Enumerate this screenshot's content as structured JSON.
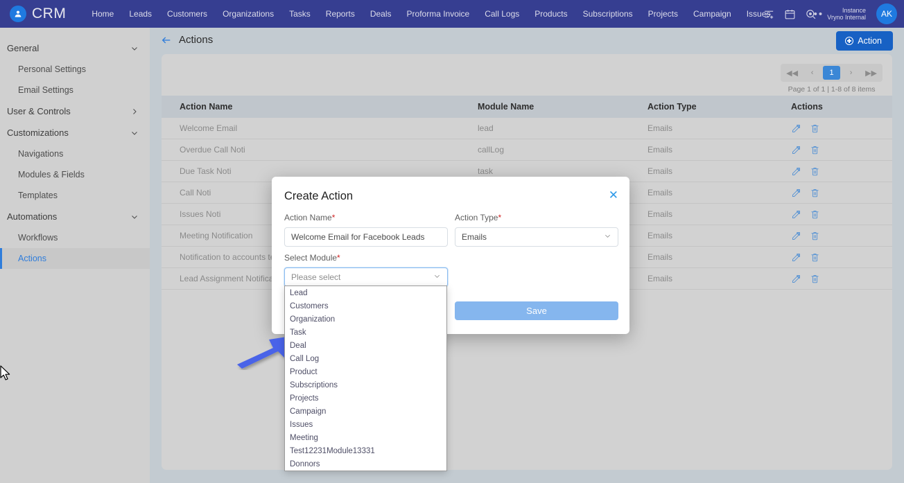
{
  "topnav": {
    "brand": "CRM",
    "links": [
      "Home",
      "Leads",
      "Customers",
      "Organizations",
      "Tasks",
      "Reports",
      "Deals",
      "Proforma Invoice",
      "Call Logs",
      "Products",
      "Subscriptions",
      "Projects",
      "Campaign",
      "Issues"
    ],
    "more": "•••",
    "instance_label": "Instance",
    "instance_name": "Vryno Internal",
    "avatar_initials": "AK",
    "bg_color": "#363e91"
  },
  "sidebar": {
    "groups": [
      {
        "label": "General",
        "expanded": true,
        "items": [
          "Personal Settings",
          "Email Settings"
        ]
      },
      {
        "label": "User & Controls",
        "expanded": false,
        "items": []
      },
      {
        "label": "Customizations",
        "expanded": true,
        "items": [
          "Navigations",
          "Modules & Fields",
          "Templates"
        ]
      },
      {
        "label": "Automations",
        "expanded": true,
        "items": [
          "Workflows",
          "Actions"
        ]
      }
    ],
    "active_item": "Actions"
  },
  "page": {
    "title": "Actions",
    "create_button": "Action"
  },
  "pagination": {
    "first": "◀◀",
    "prev": "‹",
    "current": "1",
    "next": "›",
    "last": "▶▶",
    "info": "Page 1 of 1   |   1-8 of 8 items"
  },
  "table": {
    "columns": [
      "Action Name",
      "Module Name",
      "Action Type",
      "Actions"
    ],
    "rows": [
      {
        "name": "Welcome Email",
        "module": "lead",
        "type": "Emails"
      },
      {
        "name": "Overdue Call Noti",
        "module": "callLog",
        "type": "Emails"
      },
      {
        "name": "Due Task Noti",
        "module": "task",
        "type": "Emails"
      },
      {
        "name": "Call Noti",
        "module": "",
        "type": "Emails"
      },
      {
        "name": "Issues Noti",
        "module": "",
        "type": "Emails"
      },
      {
        "name": "Meeting Notification",
        "module": "",
        "type": "Emails"
      },
      {
        "name": "Notification to accounts team",
        "module": "",
        "type": "Emails"
      },
      {
        "name": "Lead Assignment Notification",
        "module": "",
        "type": "Emails"
      }
    ]
  },
  "modal": {
    "title": "Create Action",
    "close": "✕",
    "action_name_label": "Action Name",
    "action_name_value": "Welcome Email for Facebook Leads",
    "action_type_label": "Action Type",
    "action_type_value": "Emails",
    "select_module_label": "Select Module",
    "select_module_placeholder": "Please select",
    "save_label": "Save",
    "required_marker": "*"
  },
  "module_dropdown": {
    "options": [
      "Lead",
      "Customers",
      "Organization",
      "Task",
      "Deal",
      "Call Log",
      "Product",
      "Subscriptions",
      "Projects",
      "Campaign",
      "Issues",
      "Meeting",
      "Test12231Module13331",
      "Donnors"
    ]
  },
  "colors": {
    "nav": "#363e91",
    "accent_blue": "#1761c4",
    "link_blue": "#2f7ddb",
    "save_disabled": "#85b6ee",
    "arrow_annotation": "#4a63e8"
  }
}
